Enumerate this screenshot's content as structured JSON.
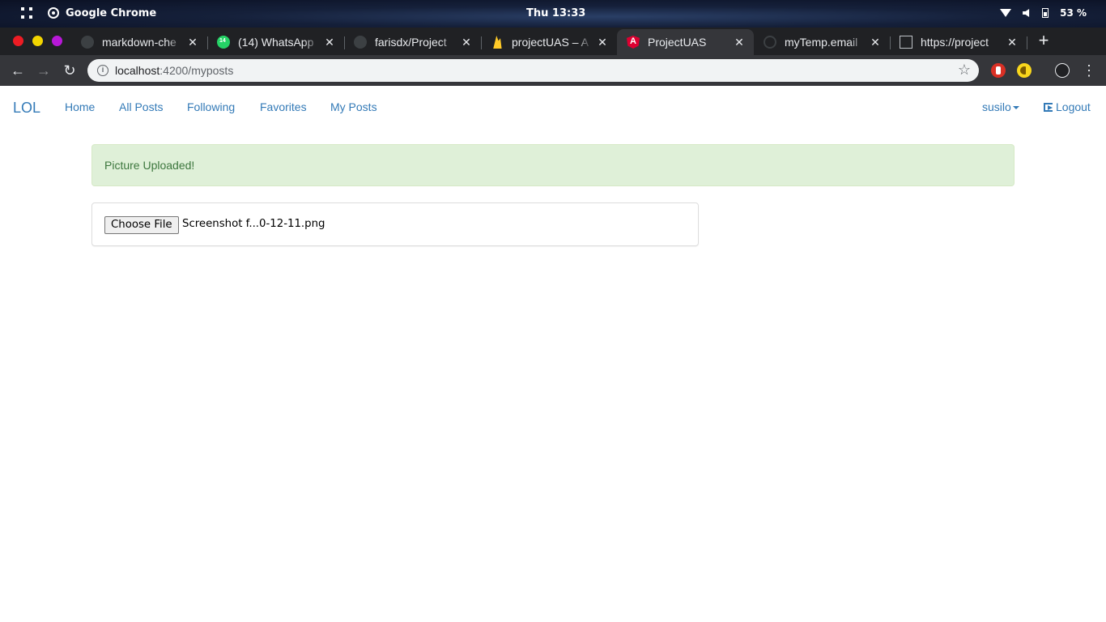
{
  "os_bar": {
    "app_name": "Google Chrome",
    "clock": "Thu 13:33",
    "battery": "53 %"
  },
  "tabs": [
    {
      "title": "markdown-che",
      "icon": "github-icon"
    },
    {
      "title": "(14) WhatsApp",
      "icon": "whatsapp-icon"
    },
    {
      "title": "farisdx/Project",
      "icon": "github-icon"
    },
    {
      "title": "projectUAS – A",
      "icon": "firebase-icon"
    },
    {
      "title": "ProjectUAS",
      "icon": "angular-icon",
      "active": true
    },
    {
      "title": "myTemp.email",
      "icon": "temp-email-icon"
    },
    {
      "title": "https://project",
      "icon": "document-icon"
    }
  ],
  "toolbar": {
    "url_host": "localhost",
    "url_rest": ":4200/myposts"
  },
  "site": {
    "brand": "LOL",
    "nav": [
      "Home",
      "All Posts",
      "Following",
      "Favorites",
      "My Posts"
    ],
    "user": "susilo",
    "logout": "Logout"
  },
  "alert": {
    "message": "Picture Uploaded!"
  },
  "upload": {
    "button_label": "Choose File",
    "file_name": "Screenshot f...0-12-11.png"
  },
  "colors": {
    "link": "#337ab7",
    "alert_bg": "#dff0d8",
    "alert_text": "#3c763d"
  }
}
